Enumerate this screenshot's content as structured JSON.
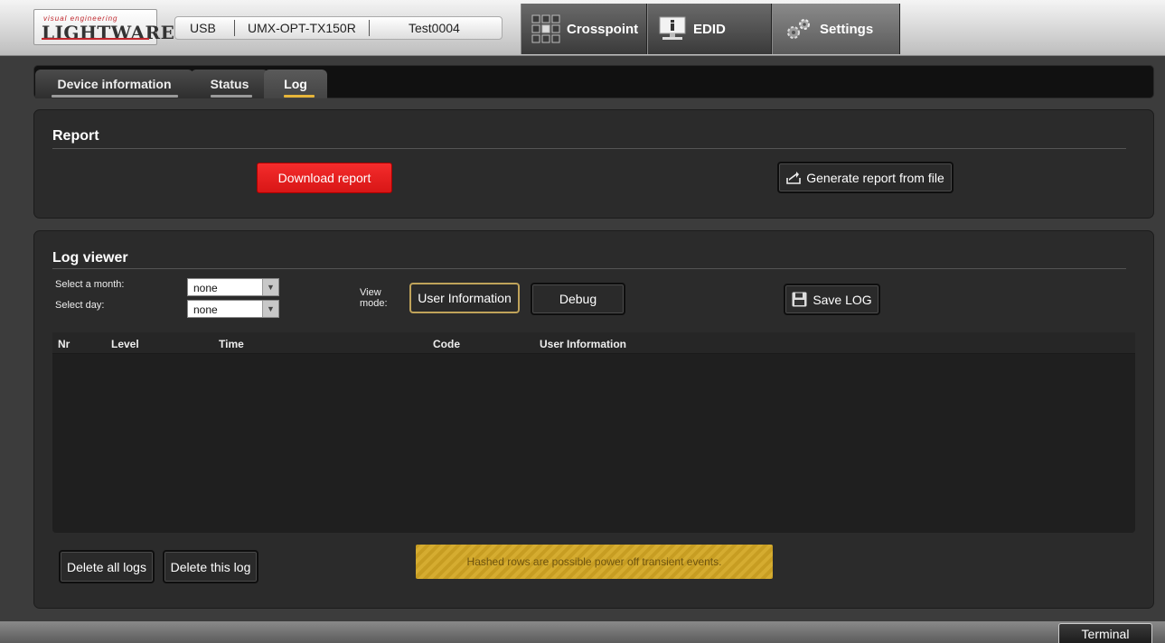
{
  "header": {
    "logo_small": "visual engineering",
    "logo_big": "LIGHTWARE",
    "connection": {
      "port": "USB",
      "model": "UMX-OPT-TX150R",
      "name": "Test0004"
    },
    "nav": [
      {
        "label": "Crosspoint",
        "icon": "crosspoint-grid-icon"
      },
      {
        "label": "EDID",
        "icon": "edid-monitor-icon"
      },
      {
        "label": "Settings",
        "icon": "gears-icon",
        "active": true
      }
    ]
  },
  "tabs": [
    {
      "label": "Device information",
      "underline_color": "#9a9a9a"
    },
    {
      "label": "Status",
      "underline_color": "#9a9a9a"
    },
    {
      "label": "Log",
      "underline_color": "#e7b53a",
      "active": true
    }
  ],
  "report": {
    "title": "Report",
    "download_label": "Download report",
    "generate_label": "Generate report from file",
    "generate_icon": "upload-folder-icon"
  },
  "log_viewer": {
    "title": "Log viewer",
    "month_label": "Select a month:",
    "day_label": "Select day:",
    "month_value": "none",
    "day_value": "none",
    "view_label_1": "View",
    "view_label_2": "mode:",
    "view_user_info": "User Information",
    "view_debug": "Debug",
    "save_log_label": "Save LOG",
    "save_icon": "floppy-disk-icon",
    "columns": [
      "Nr",
      "Level",
      "Time",
      "Code",
      "User Information"
    ],
    "rows": [],
    "delete_all_label": "Delete all logs",
    "delete_this_label": "Delete this log",
    "notice": "Hashed rows are possible power off transient events."
  },
  "footer": {
    "terminal_label": "Terminal"
  },
  "colors": {
    "accent_red": "#e81f1f",
    "accent_gold": "#e7b53a",
    "notice_bg": "#c79d22"
  }
}
